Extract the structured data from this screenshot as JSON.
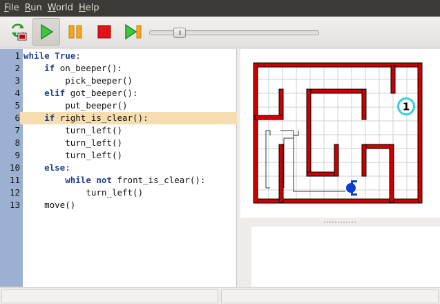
{
  "menu": {
    "items": [
      "File",
      "Run",
      "World",
      "Help"
    ],
    "mnemonics": [
      "F",
      "R",
      "W",
      "H"
    ],
    "rest": [
      "ile",
      "un",
      "orld",
      "elp"
    ]
  },
  "toolbar": {
    "buttons": [
      "reload-world",
      "run",
      "pause",
      "stop",
      "step"
    ],
    "speed_fraction": 0.15
  },
  "editor": {
    "highlighted_line": 6,
    "lines": [
      {
        "num": "1",
        "indent": "",
        "tokens": [
          {
            "t": "while",
            "kw": true
          },
          {
            "t": " ",
            "kw": false
          },
          {
            "t": "True",
            "kw": true
          },
          {
            "t": ":",
            "kw": false
          }
        ]
      },
      {
        "num": "2",
        "indent": "    ",
        "tokens": [
          {
            "t": "if",
            "kw": true
          },
          {
            "t": " on_beeper():",
            "kw": false
          }
        ]
      },
      {
        "num": "3",
        "indent": "        ",
        "tokens": [
          {
            "t": "pick_beeper()",
            "kw": false
          }
        ]
      },
      {
        "num": "4",
        "indent": "    ",
        "tokens": [
          {
            "t": "elif",
            "kw": true
          },
          {
            "t": " got_beeper():",
            "kw": false
          }
        ]
      },
      {
        "num": "5",
        "indent": "        ",
        "tokens": [
          {
            "t": "put_beeper()",
            "kw": false
          }
        ]
      },
      {
        "num": "6",
        "indent": "    ",
        "tokens": [
          {
            "t": "if",
            "kw": true
          },
          {
            "t": " right_is_clear():",
            "kw": false
          }
        ]
      },
      {
        "num": "7",
        "indent": "        ",
        "tokens": [
          {
            "t": "turn_left()",
            "kw": false
          }
        ]
      },
      {
        "num": "8",
        "indent": "        ",
        "tokens": [
          {
            "t": "turn_left()",
            "kw": false
          }
        ]
      },
      {
        "num": "9",
        "indent": "        ",
        "tokens": [
          {
            "t": "turn_left()",
            "kw": false
          }
        ]
      },
      {
        "num": "10",
        "indent": "    ",
        "tokens": [
          {
            "t": "else",
            "kw": true
          },
          {
            "t": ":",
            "kw": false
          }
        ]
      },
      {
        "num": "11",
        "indent": "        ",
        "tokens": [
          {
            "t": "while",
            "kw": true
          },
          {
            "t": " ",
            "kw": false
          },
          {
            "t": "not",
            "kw": true
          },
          {
            "t": " front_is_clear():",
            "kw": false
          }
        ]
      },
      {
        "num": "12",
        "indent": "            ",
        "tokens": [
          {
            "t": "turn_left()",
            "kw": false
          }
        ]
      },
      {
        "num": "13",
        "indent": "    ",
        "tokens": [
          {
            "t": "move()",
            "kw": false
          }
        ]
      }
    ]
  },
  "world": {
    "beeper_count": "1",
    "wall_color": "#cc0000",
    "beeper_color": "#30d0e0",
    "robot_color": "#0a3ccf",
    "grid_color": "#cfcfcf"
  },
  "status": {
    "left": "",
    "right": ""
  }
}
